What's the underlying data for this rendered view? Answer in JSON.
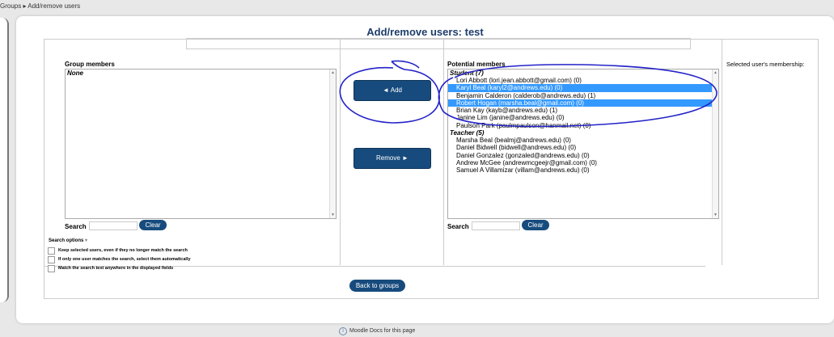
{
  "breadcrumb": "Groups ▸ Add/remove users",
  "page_title": "Add/remove users: test",
  "group_members": {
    "heading": "Group members",
    "groups": [
      {
        "label": "None",
        "items": []
      }
    ]
  },
  "potential_members": {
    "heading": "Potential members",
    "groups": [
      {
        "label": "Student (7)",
        "items": [
          {
            "text": "Lori Abbott (lori.jean.abbott@gmail.com) (0)",
            "selected": false
          },
          {
            "text": "Karyl Beal (karyl2@andrews.edu) (0)",
            "selected": true
          },
          {
            "text": "Benjamin Calderon (calderob@andrews.edu) (1)",
            "selected": false
          },
          {
            "text": "Robert Hogan (marsha.beal@gmail.com) (0)",
            "selected": true
          },
          {
            "text": "Brian Kay (kayb@andrews.edu) (1)",
            "selected": false
          },
          {
            "text": "Janine Lim (janine@andrews.edu) (0)",
            "selected": false
          },
          {
            "text": "Paulson Park (paulmpaulson@hanmail.net) (0)",
            "selected": false
          }
        ]
      },
      {
        "label": "Teacher (5)",
        "items": [
          {
            "text": "Marsha Beal (bealmj@andrews.edu) (0)",
            "selected": false
          },
          {
            "text": "Daniel Bidwell (bidwell@andrews.edu) (0)",
            "selected": false
          },
          {
            "text": "Daniel Gonzalez (gonzaled@andrews.edu) (0)",
            "selected": false
          },
          {
            "text": "Andrew McGee (andrewmcgeejr@gmail.com) (0)",
            "selected": false
          },
          {
            "text": "Samuel A Villamizar (villam@andrews.edu) (0)",
            "selected": false
          }
        ]
      }
    ]
  },
  "membership_heading": "Selected user's membership:",
  "buttons": {
    "add": "◄ Add",
    "remove": "Remove ►",
    "back": "Back to groups"
  },
  "search": {
    "label": "Search",
    "clear": "Clear",
    "left_value": "",
    "right_value": ""
  },
  "search_options": {
    "title": "Search options",
    "options": [
      {
        "label": "Keep selected users, even if they no longer match the search",
        "checked": false
      },
      {
        "label": "If only one user matches the search, select them automatically",
        "checked": false
      },
      {
        "label": "Match the search text anywhere in the displayed fields",
        "checked": false
      }
    ]
  },
  "footer": {
    "docs_link": "Moodle Docs for this page"
  },
  "colors": {
    "button": "#174b7d",
    "selection": "#3399ff",
    "title": "#1d3d6b",
    "annotation_ink": "#2323c8"
  }
}
